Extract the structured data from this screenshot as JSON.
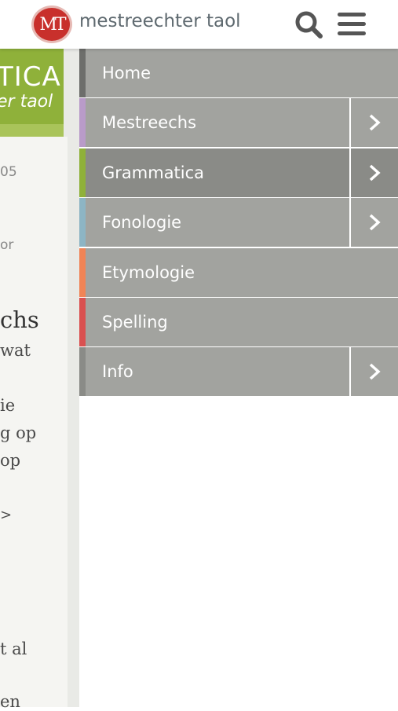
{
  "header": {
    "logo_mark": "MT",
    "site_name": "mestreechter taol"
  },
  "background_page": {
    "card_title": "TICA",
    "card_subtitle": "er taol",
    "fragments": [
      "05",
      "or",
      "chs",
      "wat",
      "ie",
      "g op",
      "op",
      ">",
      "t al",
      "en"
    ]
  },
  "menu": {
    "items": [
      {
        "label": "Home",
        "accent": "#6d6e6b",
        "has_submenu": false,
        "active": false
      },
      {
        "label": "Mestreechs",
        "accent": "#b99bc9",
        "has_submenu": true,
        "active": false
      },
      {
        "label": "Grammatica",
        "accent": "#8fb13a",
        "has_submenu": true,
        "active": true
      },
      {
        "label": "Fonologie",
        "accent": "#8db5c4",
        "has_submenu": true,
        "active": false
      },
      {
        "label": "Etymologie",
        "accent": "#f08456",
        "has_submenu": false,
        "active": false
      },
      {
        "label": "Spelling",
        "accent": "#d95050",
        "has_submenu": false,
        "active": false
      },
      {
        "label": "Info",
        "accent": "#8a8b87",
        "has_submenu": true,
        "active": false
      }
    ]
  }
}
